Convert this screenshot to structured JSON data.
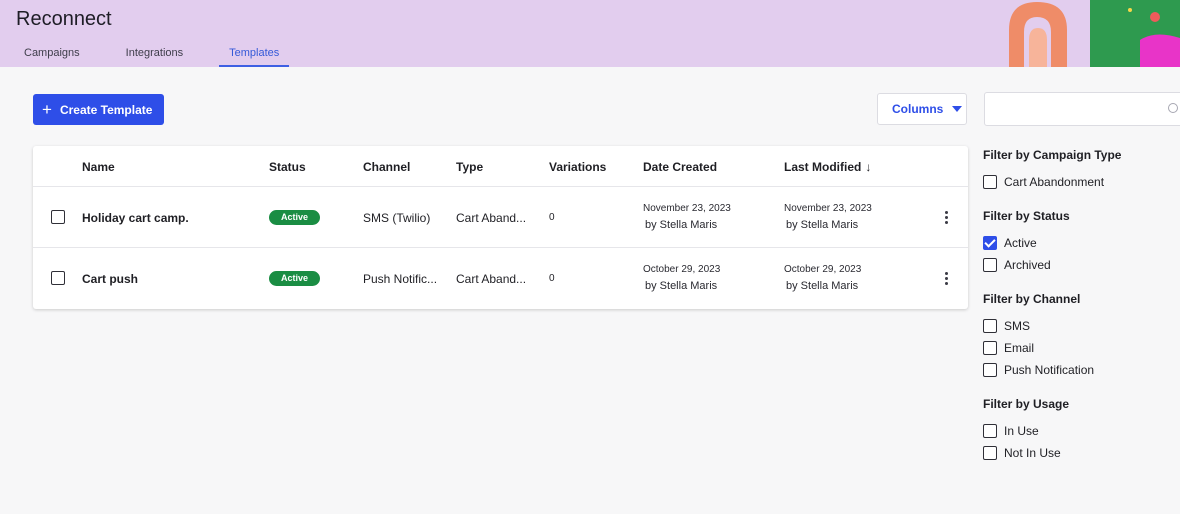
{
  "app": {
    "title": "Reconnect"
  },
  "nav": {
    "tabs": [
      {
        "label": "Campaigns"
      },
      {
        "label": "Integrations"
      },
      {
        "label": "Templates"
      }
    ]
  },
  "toolbar": {
    "create_label": "Create Template",
    "columns_label": "Columns",
    "search_placeholder": ""
  },
  "table": {
    "headers": [
      "Name",
      "Status",
      "Channel",
      "Type",
      "Variations",
      "Date Created",
      "Last Modified"
    ],
    "sort_arrow": "↓",
    "rows": [
      {
        "name": "Holiday cart camp.",
        "status": "Active",
        "channel": "SMS (Twilio)",
        "type": "Cart Aband...",
        "variations": "0",
        "created_date": "November 23, 2023",
        "created_by": "by Stella Maris",
        "modified_date": "November 23, 2023",
        "modified_by": "by Stella Maris"
      },
      {
        "name": "Cart push",
        "status": "Active",
        "channel": "Push Notific...",
        "type": "Cart Aband...",
        "variations": "0",
        "created_date": "October 29, 2023",
        "created_by": "by Stella Maris",
        "modified_date": "October 29, 2023",
        "modified_by": "by Stella Maris"
      }
    ]
  },
  "filters": {
    "campaign_type": {
      "title": "Filter by Campaign Type",
      "items": [
        {
          "label": "Cart Abandonment",
          "checked": false
        }
      ]
    },
    "status": {
      "title": "Filter by Status",
      "items": [
        {
          "label": "Active",
          "checked": true
        },
        {
          "label": "Archived",
          "checked": false
        }
      ]
    },
    "channel": {
      "title": "Filter by Channel",
      "items": [
        {
          "label": "SMS",
          "checked": false
        },
        {
          "label": "Email",
          "checked": false
        },
        {
          "label": "Push Notification",
          "checked": false
        }
      ]
    },
    "usage": {
      "title": "Filter by Usage",
      "items": [
        {
          "label": "In Use",
          "checked": false
        },
        {
          "label": "Not In Use",
          "checked": false
        }
      ]
    }
  },
  "colors": {
    "header_bg": "#e2cdee",
    "primary": "#2e4ee8",
    "active_badge": "#1a8d43",
    "accent_orange": "#ef8c68",
    "accent_green": "#2e9a4f",
    "accent_magenta": "#e834c8"
  },
  "icons": {
    "plus": "plus-icon",
    "caret": "caret-down-icon",
    "search": "search-icon",
    "kebab": "kebab-menu-icon",
    "sort": "sort-down-icon"
  }
}
